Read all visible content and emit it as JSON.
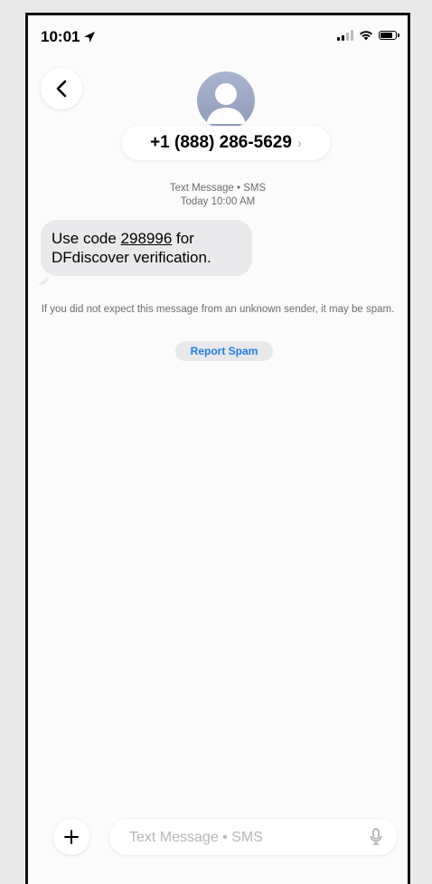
{
  "status_bar": {
    "time": "10:01",
    "icons": [
      "location-arrow-icon",
      "signal-icon",
      "wifi-icon",
      "battery-icon"
    ]
  },
  "header": {
    "back_icon": "chevron-left-icon",
    "contact_number": "+1 (888) 286-5629",
    "chevron": "›"
  },
  "conversation": {
    "meta_line1": "Text Message • SMS",
    "meta_line2": "Today 10:00 AM",
    "message": {
      "prefix": "Use code ",
      "code": "298996",
      "suffix": " for DFdiscover verification."
    },
    "spam_notice": "If you did not expect this message from an unknown sender, it may be spam.",
    "report_button": "Report Spam"
  },
  "composer": {
    "plus_icon": "plus-icon",
    "placeholder": "Text Message • SMS",
    "mic_icon": "microphone-icon"
  },
  "colors": {
    "bubble": "#e9e9eb",
    "link_blue": "#1f7ee6",
    "meta_gray": "#6d6d72"
  }
}
